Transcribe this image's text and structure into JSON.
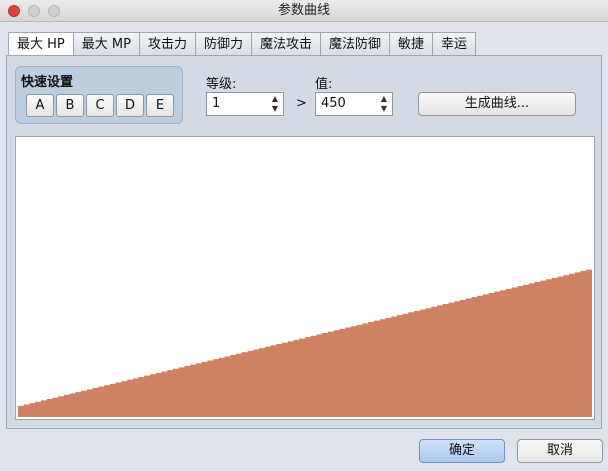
{
  "window": {
    "title": "参数曲线"
  },
  "tabs": [
    {
      "label": "最大 HP",
      "active": true
    },
    {
      "label": "最大 MP",
      "active": false
    },
    {
      "label": "攻击力",
      "active": false
    },
    {
      "label": "防御力",
      "active": false
    },
    {
      "label": "魔法攻击",
      "active": false
    },
    {
      "label": "魔法防御",
      "active": false
    },
    {
      "label": "敏捷",
      "active": false
    },
    {
      "label": "幸运",
      "active": false
    }
  ],
  "quick_setup": {
    "title": "快速设置",
    "buttons": [
      "A",
      "B",
      "C",
      "D",
      "E"
    ]
  },
  "level": {
    "label": "等级:",
    "value": "1"
  },
  "comparator": ">",
  "value_field": {
    "label": "值:",
    "value": "450"
  },
  "generate_button": "生成曲线...",
  "curve": {
    "color": "#cf8262",
    "start_fraction": 0.04,
    "end_fraction": 0.53
  },
  "footer": {
    "ok_label": "确定",
    "cancel_label": "取消"
  }
}
